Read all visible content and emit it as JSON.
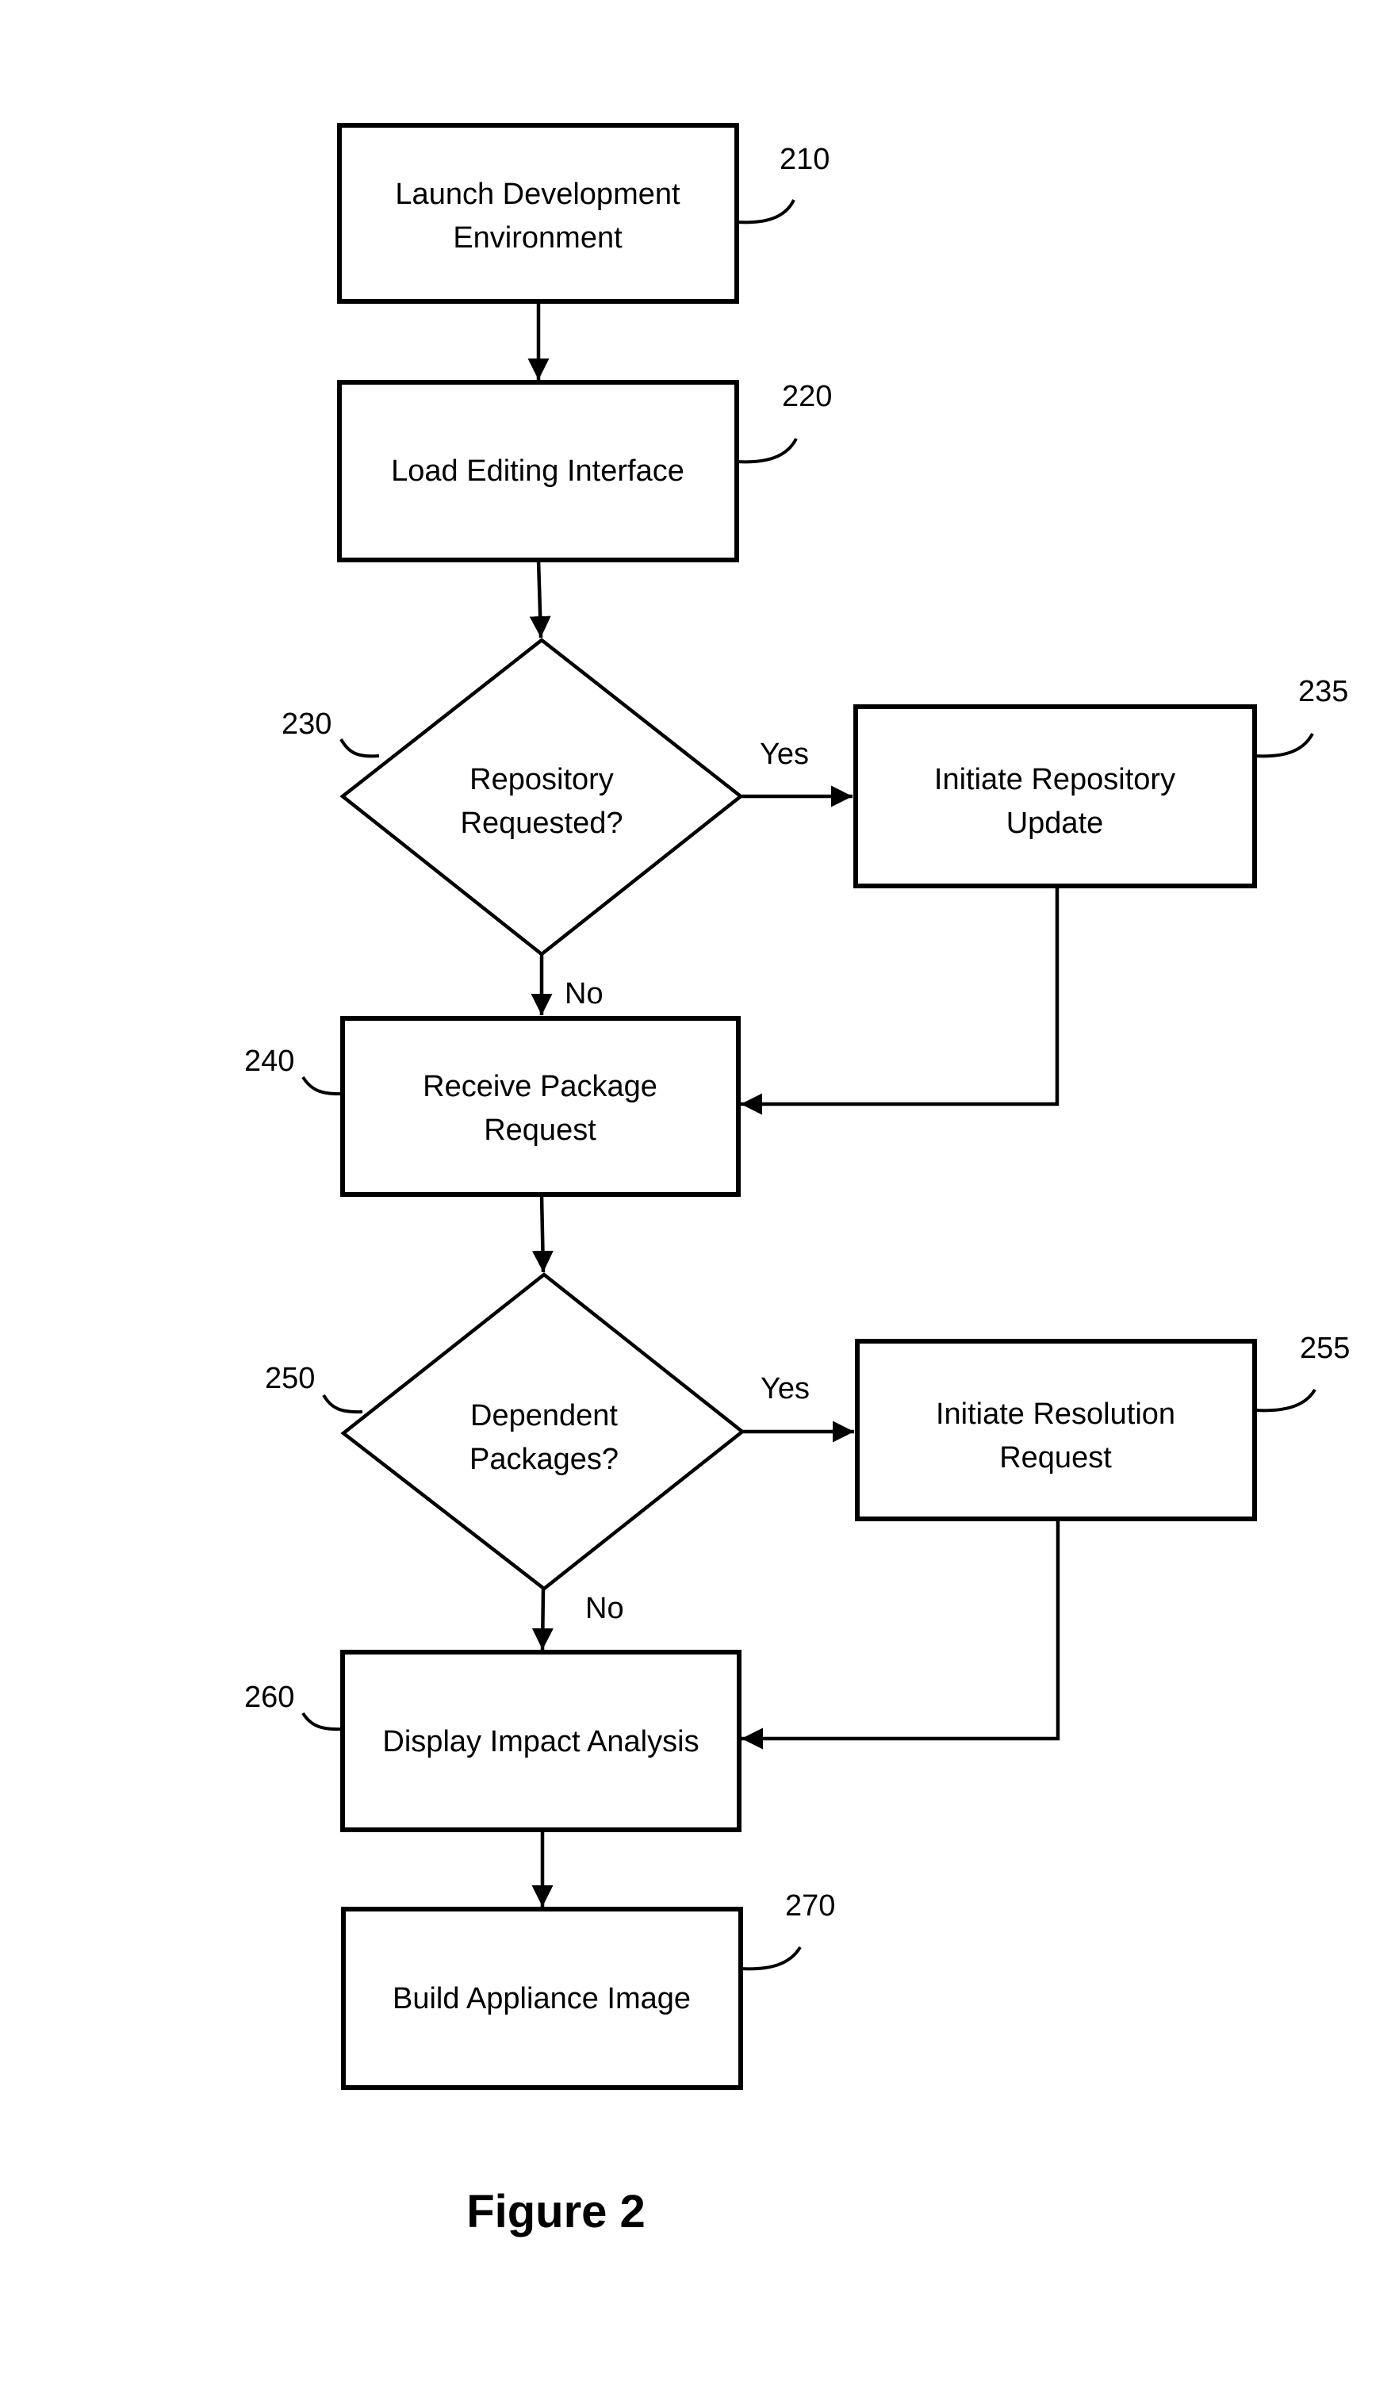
{
  "figure": {
    "caption": "Figure 2"
  },
  "nodes": {
    "n210": {
      "ref": "210",
      "shape": "process",
      "lines": [
        "Launch Development",
        "Environment"
      ]
    },
    "n220": {
      "ref": "220",
      "shape": "process",
      "lines": [
        "Load Editing Interface"
      ]
    },
    "n230": {
      "ref": "230",
      "shape": "decision",
      "lines": [
        "Repository",
        "Requested?"
      ]
    },
    "n235": {
      "ref": "235",
      "shape": "process",
      "lines": [
        "Initiate Repository",
        "Update"
      ]
    },
    "n240": {
      "ref": "240",
      "shape": "process",
      "lines": [
        "Receive Package",
        "Request"
      ]
    },
    "n250": {
      "ref": "250",
      "shape": "decision",
      "lines": [
        "Dependent",
        "Packages?"
      ]
    },
    "n255": {
      "ref": "255",
      "shape": "process",
      "lines": [
        "Initiate Resolution",
        "Request"
      ]
    },
    "n260": {
      "ref": "260",
      "shape": "process",
      "lines": [
        "Display Impact Analysis"
      ]
    },
    "n270": {
      "ref": "270",
      "shape": "process",
      "lines": [
        "Build Appliance Image"
      ]
    }
  },
  "edges": [
    {
      "from": "210",
      "to": "220",
      "label": ""
    },
    {
      "from": "220",
      "to": "230",
      "label": ""
    },
    {
      "from": "230",
      "to": "235",
      "label": "Yes"
    },
    {
      "from": "230",
      "to": "240",
      "label": "No"
    },
    {
      "from": "235",
      "to": "240",
      "label": ""
    },
    {
      "from": "240",
      "to": "250",
      "label": ""
    },
    {
      "from": "250",
      "to": "255",
      "label": "Yes"
    },
    {
      "from": "250",
      "to": "260",
      "label": "No"
    },
    {
      "from": "255",
      "to": "260",
      "label": ""
    },
    {
      "from": "260",
      "to": "270",
      "label": ""
    }
  ],
  "branch_labels": {
    "yes_230": "Yes",
    "no_230": "No",
    "yes_250": "Yes",
    "no_250": "No"
  }
}
